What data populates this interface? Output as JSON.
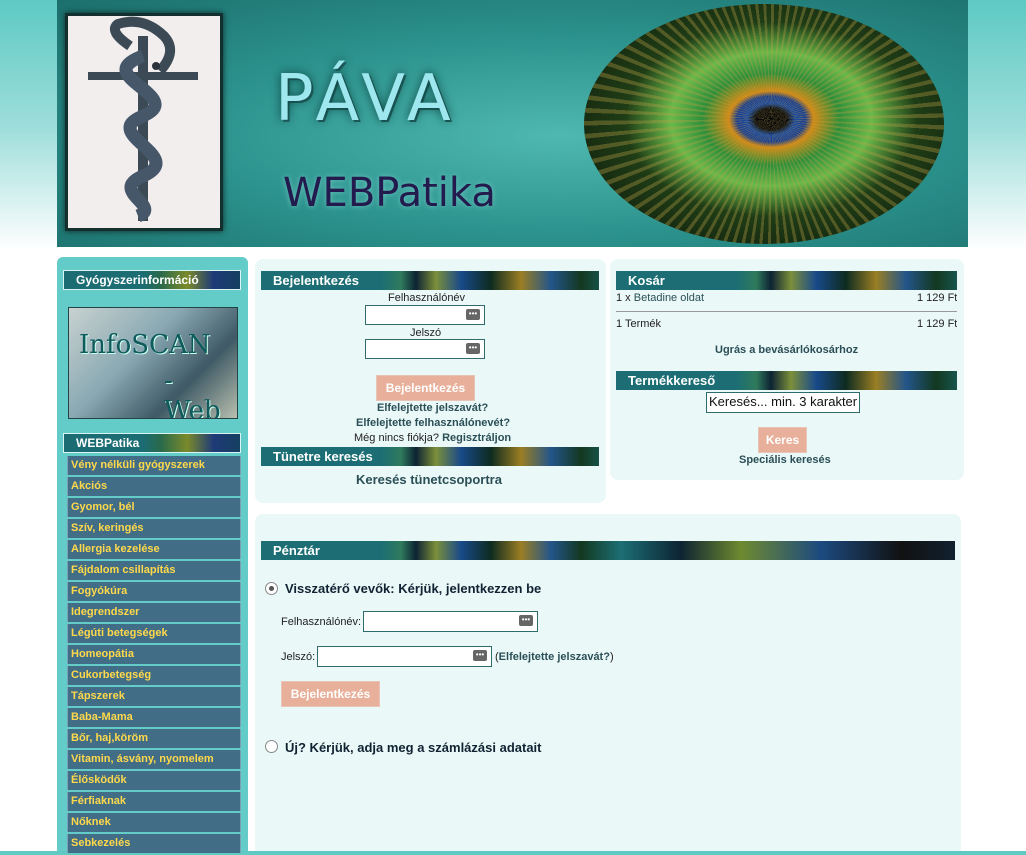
{
  "banner": {
    "title": "PÁVA",
    "subtitle": "WEBPatika"
  },
  "left": {
    "info_heading": "Gyógyszerinformáció",
    "infoscan_line1": "InfoSCAN",
    "infoscan_line2": "- Web",
    "webpatika_heading": "WEBPatika",
    "categories": [
      "Vény nélküli gyógyszerek",
      "Akciós",
      "Gyomor, bél",
      "Szív, keringés",
      "Allergia kezelése",
      "Fájdalom csillapítás",
      "Fogyókúra",
      "Idegrendszer",
      "Légúti betegségek",
      "Homeopátia",
      "Cukorbetegség",
      "Tápszerek",
      "Baba-Mama",
      "Bőr, haj,köröm",
      "Vitamin, ásvány, nyomelem",
      "Élősködők",
      "Férfiaknak",
      "Nőknek",
      "Sebkezelés"
    ]
  },
  "login": {
    "heading": "Bejelentkezés",
    "username_label": "Felhasználónév",
    "password_label": "Jelszó",
    "button": "Bejelentkezés",
    "forgot_password": "Elfelejtette jelszavát?",
    "forgot_username": "Elfelejtette felhasználónevét?",
    "no_account": "Még nincs fiókja?",
    "register": "Regisztráljon"
  },
  "symptom": {
    "heading": "Tünetre keresés",
    "link": "Keresés tünetcsoportra"
  },
  "cart": {
    "heading": "Kosár",
    "item_qty": "1 x",
    "item_name": "Betadine oldat",
    "item_price": "1 129 Ft",
    "total_label": "1 Termék",
    "total_price": "1 129 Ft",
    "goto": "Ugrás a bevásárlókosárhoz"
  },
  "product_search": {
    "heading": "Termékkereső",
    "input_value": "Keresés... min. 3 karakter",
    "button": "Keres",
    "special": "Speciális keresés"
  },
  "checkout": {
    "heading": "Pénztár",
    "returning_label": "Visszatérő vevők: Kérjük, jelentkezzen be",
    "username_label": "Felhasználónév:",
    "password_label": "Jelszó:",
    "forgot_open": "(",
    "forgot_link": "Elfelejtette jelszavát?",
    "forgot_close": ")",
    "button": "Bejelentkezés",
    "new_label": "Új? Kérjük, adja meg a számlázási adatait"
  },
  "colors": {
    "teal": "#63cbc8",
    "category_bg": "#416d87",
    "category_text": "#ffd94a",
    "button_bg": "#e8b09a",
    "panel_bg": "#eaf8f7"
  }
}
